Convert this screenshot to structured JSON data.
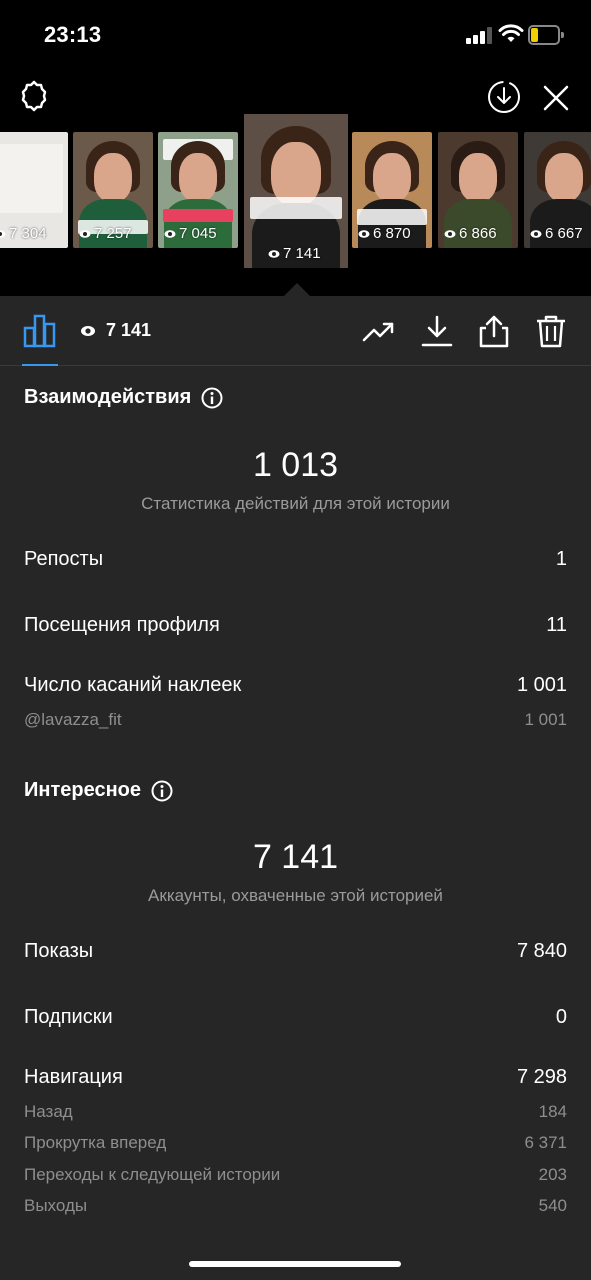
{
  "status_bar": {
    "time": "23:13",
    "battery_level": 0.25
  },
  "thumbnails": [
    {
      "views": "7 304",
      "bg": "#e9e7e3"
    },
    {
      "views": "7 257",
      "bg": "#6b5a4a"
    },
    {
      "views": "7 045",
      "bg": "#8fa08a"
    },
    {
      "views": "7 141",
      "bg": "#5d4f45",
      "selected": true
    },
    {
      "views": "6 870",
      "bg": "#b88a5a"
    },
    {
      "views": "6 866",
      "bg": "#4c3a2e"
    },
    {
      "views": "6 667",
      "bg": "#3f3a36"
    }
  ],
  "toolbar": {
    "views": "7 141"
  },
  "interactions": {
    "title": "Взаимодействия",
    "total": "1 013",
    "subtitle": "Статистика действий для этой истории",
    "rows": [
      {
        "label": "Репосты",
        "value": "1"
      },
      {
        "label": "Посещения профиля",
        "value": "11"
      },
      {
        "label": "Число касаний наклеек",
        "value": "1 001"
      }
    ],
    "sticker": {
      "label": "@lavazza_fit",
      "value": "1 001"
    }
  },
  "discovery": {
    "title": "Интересное",
    "total": "7 141",
    "subtitle": "Аккаунты, охваченные этой историей",
    "rows": [
      {
        "label": "Показы",
        "value": "7 840"
      },
      {
        "label": "Подписки",
        "value": "0"
      },
      {
        "label": "Навигация",
        "value": "7 298"
      }
    ],
    "navigation": [
      {
        "label": "Назад",
        "value": "184"
      },
      {
        "label": "Прокрутка вперед",
        "value": "6 371"
      },
      {
        "label": "Переходы к следующей истории",
        "value": "203"
      },
      {
        "label": "Выходы",
        "value": "540"
      }
    ]
  },
  "colors": {
    "accent": "#3897f0",
    "panel": "#262626",
    "muted": "#8e8e8e"
  }
}
